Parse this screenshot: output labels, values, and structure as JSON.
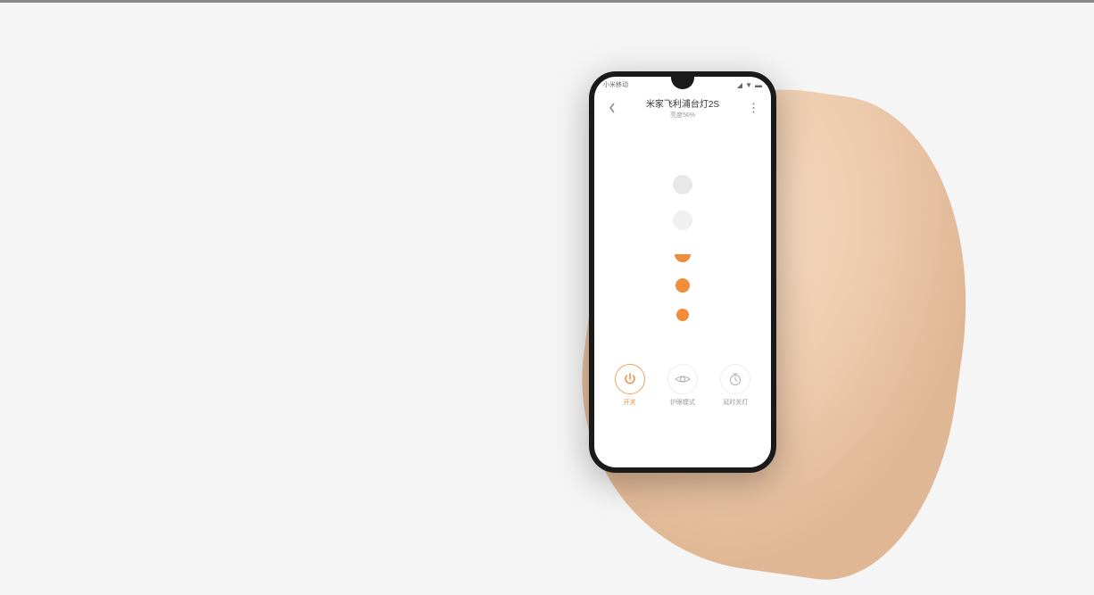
{
  "status_bar": {
    "carrier": "小米移动"
  },
  "header": {
    "title": "米家飞利浦台灯2S",
    "subtitle": "亮度56%"
  },
  "brightness": {
    "value_percent": 56
  },
  "actions": {
    "power": {
      "label": "开关",
      "active": true
    },
    "eyecare": {
      "label": "护眼模式",
      "active": false
    },
    "timer": {
      "label": "延时关灯",
      "active": false
    }
  },
  "colors": {
    "accent": "#f08c3a",
    "muted": "#999"
  }
}
